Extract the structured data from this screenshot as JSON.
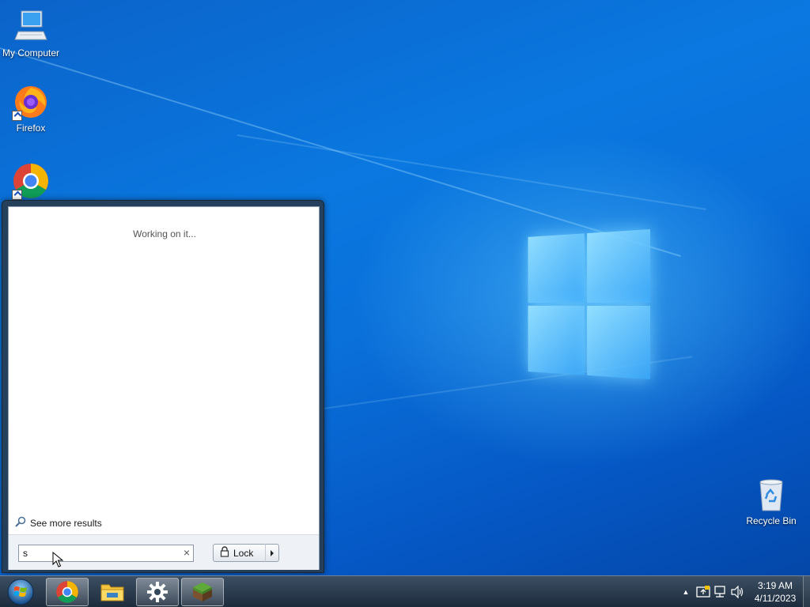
{
  "desktop": {
    "icons": [
      {
        "label": "My Computer",
        "icon": "computer-icon"
      },
      {
        "label": "Firefox",
        "icon": "firefox-icon"
      },
      {
        "label": "",
        "icon": "chrome-icon"
      },
      {
        "label": "Recycle Bin",
        "icon": "recycle-bin-icon"
      }
    ]
  },
  "start_menu": {
    "status_text": "Working on it...",
    "see_more_label": "See more results",
    "search_value": "s",
    "clear_glyph": "×",
    "lock_label": "Lock"
  },
  "taskbar": {
    "buttons": [
      {
        "name": "chrome",
        "icon": "chrome-icon",
        "active": true
      },
      {
        "name": "file-explorer",
        "icon": "folder-icon",
        "active": false
      },
      {
        "name": "settings",
        "icon": "gear-icon",
        "active": true
      },
      {
        "name": "minecraft",
        "icon": "grass-block-icon",
        "active": true
      }
    ],
    "tray": {
      "overflow_glyph": "▲",
      "time": "3:19 AM",
      "date": "4/11/2023"
    }
  },
  "colors": {
    "wallpaper": "#0a6fd9",
    "taskbar": "#2a3a4d",
    "start_menu_frame": "#283c50"
  }
}
